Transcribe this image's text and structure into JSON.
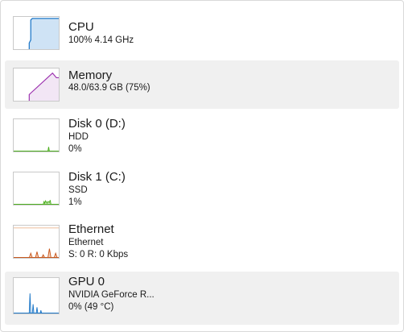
{
  "performance_list": {
    "items": [
      {
        "id": "cpu",
        "title": "CPU",
        "lines": [
          "100%  4.14 GHz"
        ],
        "color": "#1e78c8",
        "utilization_percent": 100
      },
      {
        "id": "memory",
        "title": "Memory",
        "lines": [
          "48.0/63.9 GB (75%)"
        ],
        "color": "#9b2fae",
        "utilization_percent": 75
      },
      {
        "id": "disk0",
        "title": "Disk 0 (D:)",
        "lines": [
          "HDD",
          "0%"
        ],
        "color": "#4caf1e",
        "utilization_percent": 0
      },
      {
        "id": "disk1",
        "title": "Disk 1 (C:)",
        "lines": [
          "SSD",
          "1%"
        ],
        "color": "#4caf1e",
        "utilization_percent": 1
      },
      {
        "id": "ethernet",
        "title": "Ethernet",
        "lines": [
          "Ethernet",
          "S: 0  R: 0 Kbps"
        ],
        "color": "#c8581e"
      },
      {
        "id": "gpu0",
        "title": "GPU 0",
        "lines": [
          "NVIDIA GeForce R...",
          "0%  (49 °C)"
        ],
        "color": "#1e78c8",
        "utilization_percent": 0
      }
    ]
  }
}
